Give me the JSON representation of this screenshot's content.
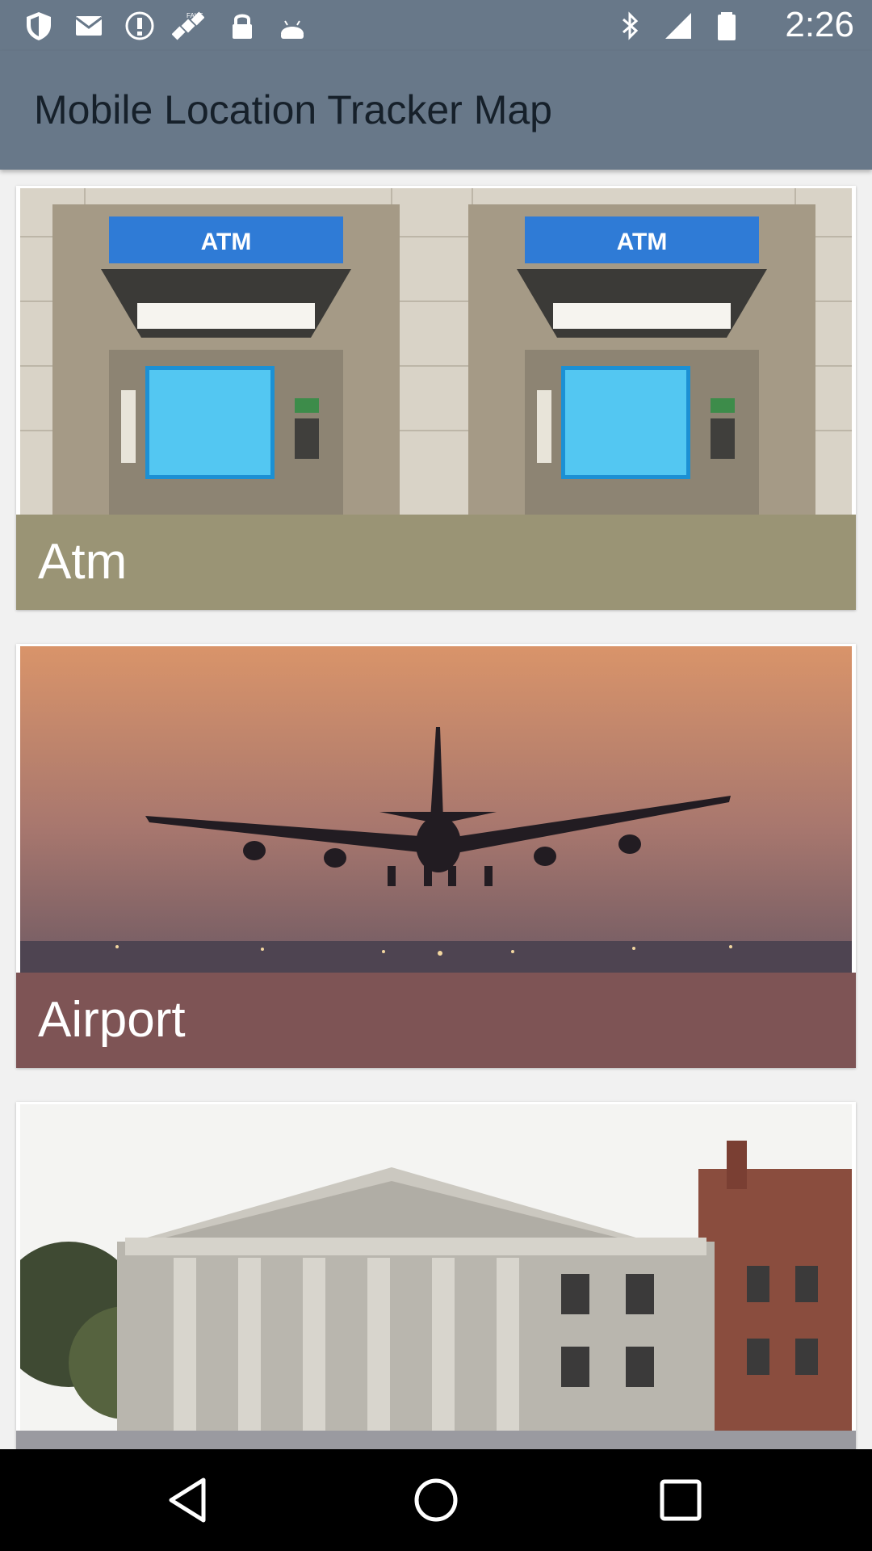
{
  "status_bar": {
    "time": "2:26",
    "left_icons": [
      "shield-icon",
      "email-icon",
      "info-icon",
      "satellite-icon",
      "lock-icon",
      "android-icon"
    ],
    "right_icons": [
      "bluetooth-icon",
      "signal-icon",
      "battery-icon"
    ]
  },
  "app_bar": {
    "title": "Mobile Location Tracker Map"
  },
  "cards": [
    {
      "label": "Atm",
      "label_bg": "#9a9475",
      "image": "atm-machines-image"
    },
    {
      "label": "Airport",
      "label_bg": "#7e5455",
      "image": "airplane-landing-image"
    },
    {
      "label": "",
      "label_bg": "#9a9aa0",
      "image": "bank-building-image"
    }
  ],
  "nav_bar": {
    "icons": [
      "back-icon",
      "home-icon",
      "recents-icon"
    ]
  }
}
